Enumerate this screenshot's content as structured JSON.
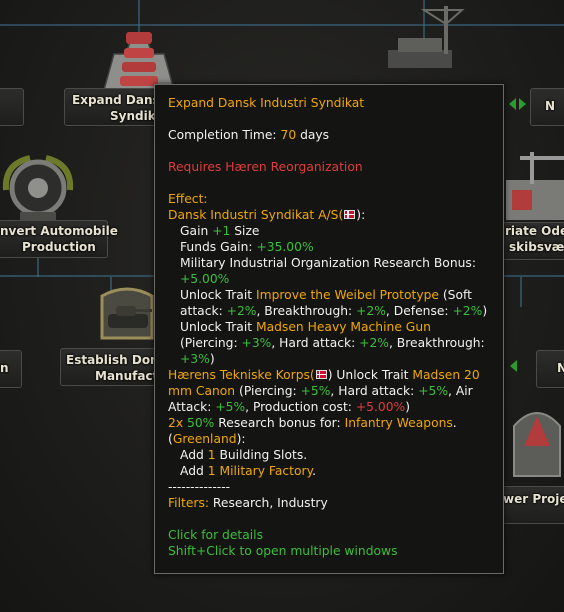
{
  "background_nodes": {
    "expand_dansk": {
      "line1": "Expand Dansk",
      "line2": "Syndik"
    },
    "convert_automobile": {
      "line1": "nvert Automobile",
      "line2": "Production"
    },
    "establish_domestic": {
      "line1": "Establish Dome",
      "line2": "Manufactu"
    },
    "left_fragment": {
      "text": "n"
    },
    "right_top": {
      "line1": "riate Oder",
      "line2": "skibsværf"
    },
    "right_power": {
      "text": "wer Projec"
    },
    "right_n_top": {
      "text": "N"
    },
    "right_n_mid": {
      "text": "N"
    }
  },
  "tooltip": {
    "title": "Expand Dansk Industri Syndikat",
    "completion_label": "Completion Time: ",
    "completion_value": "70",
    "completion_unit": " days",
    "requires": "Requires Hæren Reorganization",
    "effect_label": "Effect:",
    "company1_name": "Dansk Industri Syndikat A/S(",
    "company1_close": "):",
    "gain_label": "Gain ",
    "gain_value": "+1",
    "gain_suffix": " Size",
    "funds_label": "Funds Gain: ",
    "funds_value": "+35.00%",
    "research_bonus_label": "Military Industrial Organization Research Bonus:",
    "research_bonus_value": "+5.00%",
    "unlock_label": "Unlock Trait ",
    "trait1_name": "Improve the Weibel Prototype",
    "trait1_soft_pre": " (Soft attack: ",
    "trait1_soft_val": "+2%",
    "trait1_break_pre": ", Breakthrough: ",
    "trait1_break_val": "+2%",
    "trait1_def_pre": ", Defense: ",
    "trait1_def_val": "+2%",
    "trait1_close": ")",
    "trait2_name": "Madsen Heavy Machine Gun",
    "trait2_pierce_pre": "(Piercing: ",
    "trait2_pierce_val": "+3%",
    "trait2_hard_pre": ", Hard attack: ",
    "trait2_hard_val": "+2%",
    "trait2_break_pre": ", Breakthrough:",
    "trait2_break_val": "+3%",
    "trait2_close": ")",
    "company2_name": "Hærens Tekniske Korps(",
    "company2_close": ") Unlock Trait ",
    "trait3_name": "Madsen 20 mm Canon",
    "trait3_pierce_pre": " (Piercing: ",
    "trait3_pierce_val": "+5%",
    "trait3_hard_pre": ", Hard attack: ",
    "trait3_hard_val": "+5%",
    "trait3_air_pre": ", Air Attack: ",
    "trait3_air_val": "+5%",
    "trait3_cost_pre": ", Production cost: ",
    "trait3_cost_val": "+5.00%",
    "trait3_close": ")",
    "research_count": "2x",
    "research_pct": "50%",
    "research_text": " Research bonus for: ",
    "research_target": "Infantry Weapons",
    "research_end": ".",
    "state_open": "(",
    "state_name": "Greenland",
    "state_close": "):",
    "add_label": "Add ",
    "add1_value": "1",
    "add1_suffix": " Building Slots.",
    "add2_value": "1",
    "add2_suffix": "Military Factory",
    "add2_end": ".",
    "separator": "--------------",
    "filters_label": "Filters:",
    "filters_value": " Research, Industry",
    "hint1": "Click for details",
    "hint2": "Shift+Click to open multiple windows"
  },
  "colors": {
    "highlight": "#f0a800",
    "positive": "#3bbf3b",
    "negative": "#e03c3c",
    "connector": "#3e6f8a"
  },
  "icons": [
    "factory-stack-icon",
    "tire-wreath-icon",
    "tank-icon",
    "crane-shipyard-icon",
    "flag-denmark-icon"
  ]
}
